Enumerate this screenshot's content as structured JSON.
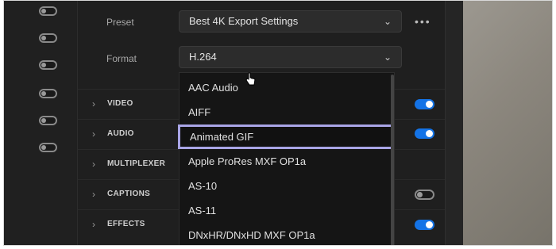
{
  "preset": {
    "label": "Preset",
    "value": "Best 4K Export Settings",
    "more": "•••"
  },
  "format": {
    "label": "Format",
    "value": "H.264"
  },
  "sections": [
    {
      "name": "VIDEO",
      "toggle": "on"
    },
    {
      "name": "AUDIO",
      "toggle": "on"
    },
    {
      "name": "MULTIPLEXER",
      "toggle": "none"
    },
    {
      "name": "CAPTIONS",
      "toggle": "off"
    },
    {
      "name": "EFFECTS",
      "toggle": "on"
    }
  ],
  "format_options": [
    "AAC Audio",
    "AIFF",
    "Animated GIF",
    "Apple ProRes MXF OP1a",
    "AS-10",
    "AS-11",
    "DNxHR/DNxHD MXF OP1a"
  ],
  "highlighted_option": "Animated GIF",
  "left_toggles": [
    "off",
    "off",
    "off",
    "off",
    "off",
    "off"
  ],
  "colors": {
    "accent": "#1473e6",
    "highlight": "#a9a5e6"
  }
}
